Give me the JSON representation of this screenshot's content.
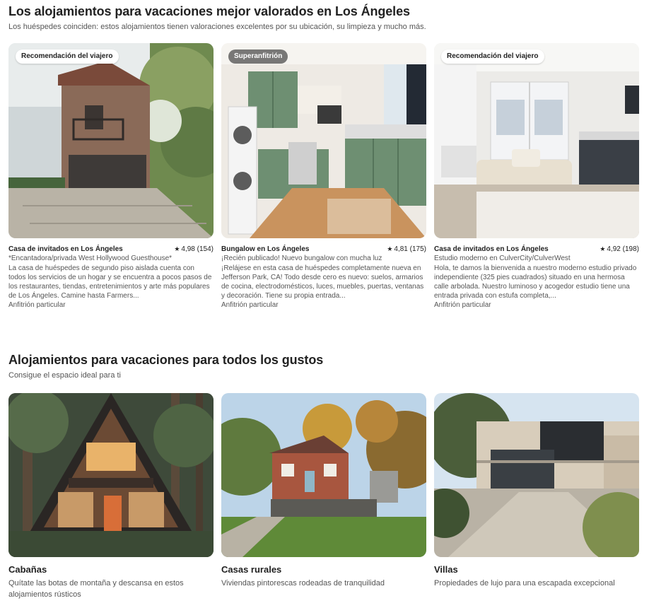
{
  "top_rated": {
    "title": "Los alojamientos para vacaciones mejor valorados en Los Ángeles",
    "subtitle": "Los huéspedes coinciden: estos alojamientos tienen valoraciones excelentes por su ubicación, su limpieza y mucho más.",
    "listings": [
      {
        "badge": "Recomendación del viajero",
        "type": "Casa de invitados en Los Ángeles",
        "rating": "4,98 (154)",
        "name": "*Encantadora/privada West Hollywood Guesthouse*",
        "description": "La casa de huéspedes de segundo piso aislada cuenta con todos los servicios de un hogar y se encuentra a pocos pasos de los restaurantes, tiendas, entretenimientos y arte más populares de Los Ángeles. Camine hasta Farmers...",
        "host": "Anfitrión particular"
      },
      {
        "badge": "Superanfitrión",
        "type": "Bungalow en Los Ángeles",
        "rating": "4,81 (175)",
        "name": "¡Recién publicado! Nuevo bungalow con mucha luz",
        "description": "¡Relájese en esta casa de huéspedes completamente nueva en Jefferson Park, CA! Todo desde cero es nuevo: suelos, armarios de cocina, electrodomésticos, luces, muebles, puertas, ventanas y decoración. Tiene su propia entrada...",
        "host": "Anfitrión particular"
      },
      {
        "badge": "Recomendación del viajero",
        "type": "Casa de invitados en Los Ángeles",
        "rating": "4,92 (198)",
        "name": "Estudio moderno en CulverCity/CulverWest",
        "description": "Hola, te damos la bienvenida a nuestro moderno estudio privado independiente (325 pies cuadrados) situado en una hermosa calle arbolada. Nuestro luminoso y acogedor estudio tiene una entrada privada con estufa completa,...",
        "host": "Anfitrión particular"
      }
    ]
  },
  "categories": {
    "title": "Alojamientos para vacaciones para todos los gustos",
    "subtitle": "Consigue el espacio ideal para ti",
    "items": [
      {
        "title": "Cabañas",
        "description": "Quítate las botas de montaña y descansa en estos alojamientos rústicos"
      },
      {
        "title": "Casas rurales",
        "description": "Viviendas pintorescas rodeadas de tranquilidad"
      },
      {
        "title": "Villas",
        "description": "Propiedades de lujo para una escapada excepcional"
      }
    ]
  },
  "icons": {
    "rating": "star-icon"
  },
  "colors": {
    "text": "#222222",
    "secondary_text": "#555555",
    "badge_light_bg": "#ffffff",
    "badge_dark_bg": "#4a4a4a"
  }
}
